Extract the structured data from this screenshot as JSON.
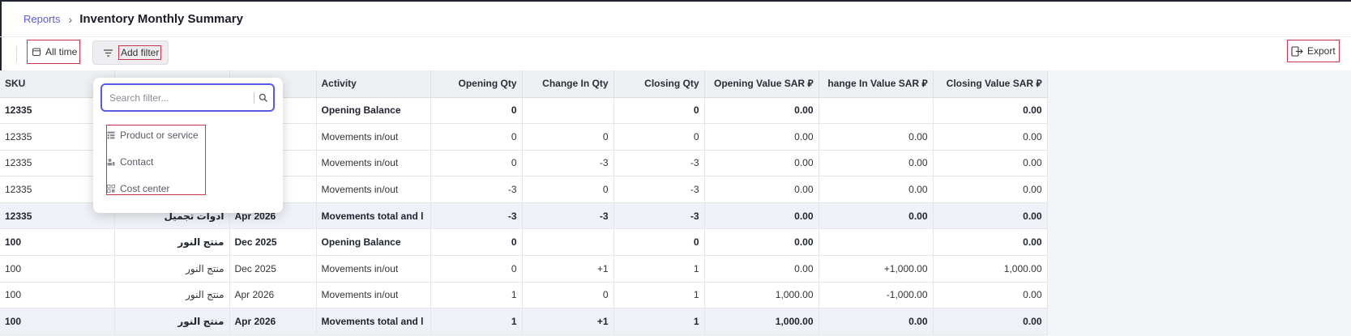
{
  "breadcrumb": {
    "parent": "Reports",
    "separator": "›",
    "title": "Inventory Monthly Summary"
  },
  "toolbar": {
    "date_range_label": "All time",
    "add_filter_label": "Add filter",
    "export_label": "Export"
  },
  "filter_dropdown": {
    "search_placeholder": "Search filter...",
    "options": [
      {
        "label": "Product or service",
        "icon": "product-icon"
      },
      {
        "label": "Contact",
        "icon": "contact-icon"
      },
      {
        "label": "Cost center",
        "icon": "cost-center-icon"
      }
    ]
  },
  "table": {
    "columns": [
      "SKU",
      "",
      "",
      "Activity",
      "Opening Qty",
      "Change In Qty",
      "Closing Qty",
      "Opening Value  SAR ⃁",
      "hange In Value  SAR ⃁",
      "Closing Value  SAR ⃁"
    ],
    "rows": [
      {
        "style": "bold",
        "cells": [
          "12335",
          "",
          "",
          "Opening Balance",
          "0",
          "",
          "0",
          "0.00",
          "",
          "0.00"
        ]
      },
      {
        "style": "normal",
        "cells": [
          "12335",
          "",
          "",
          "Movements in/out",
          "0",
          "0",
          "0",
          "0.00",
          "0.00",
          "0.00"
        ]
      },
      {
        "style": "normal",
        "cells": [
          "12335",
          "",
          "",
          "Movements in/out",
          "0",
          "-3",
          "-3",
          "0.00",
          "0.00",
          "0.00"
        ]
      },
      {
        "style": "normal",
        "cells": [
          "12335",
          "",
          "",
          "Movements in/out",
          "-3",
          "0",
          "-3",
          "0.00",
          "0.00",
          "0.00"
        ]
      },
      {
        "style": "total",
        "cells": [
          "12335",
          "ادوات تجميل",
          "Apr 2026",
          "Movements total and l",
          "-3",
          "-3",
          "-3",
          "0.00",
          "0.00",
          "0.00"
        ]
      },
      {
        "style": "bold",
        "cells": [
          "100",
          "منتج النور",
          "Dec 2025",
          "Opening Balance",
          "0",
          "",
          "0",
          "0.00",
          "",
          "0.00"
        ]
      },
      {
        "style": "normal",
        "cells": [
          "100",
          "منتج النور",
          "Dec 2025",
          "Movements in/out",
          "0",
          "+1",
          "1",
          "0.00",
          "+1,000.00",
          "1,000.00"
        ]
      },
      {
        "style": "normal",
        "cells": [
          "100",
          "منتج النور",
          "Apr 2026",
          "Movements in/out",
          "1",
          "0",
          "1",
          "1,000.00",
          "-1,000.00",
          "0.00"
        ]
      },
      {
        "style": "total",
        "cells": [
          "100",
          "منتج النور",
          "Apr 2026",
          "Movements total and l",
          "1",
          "+1",
          "1",
          "1,000.00",
          "0.00",
          "0.00"
        ]
      }
    ]
  },
  "colors": {
    "accent": "#5b5be0",
    "highlight_box": "#c8354f",
    "header_bg": "#eef0f4",
    "total_row_bg": "#eef1f6"
  }
}
